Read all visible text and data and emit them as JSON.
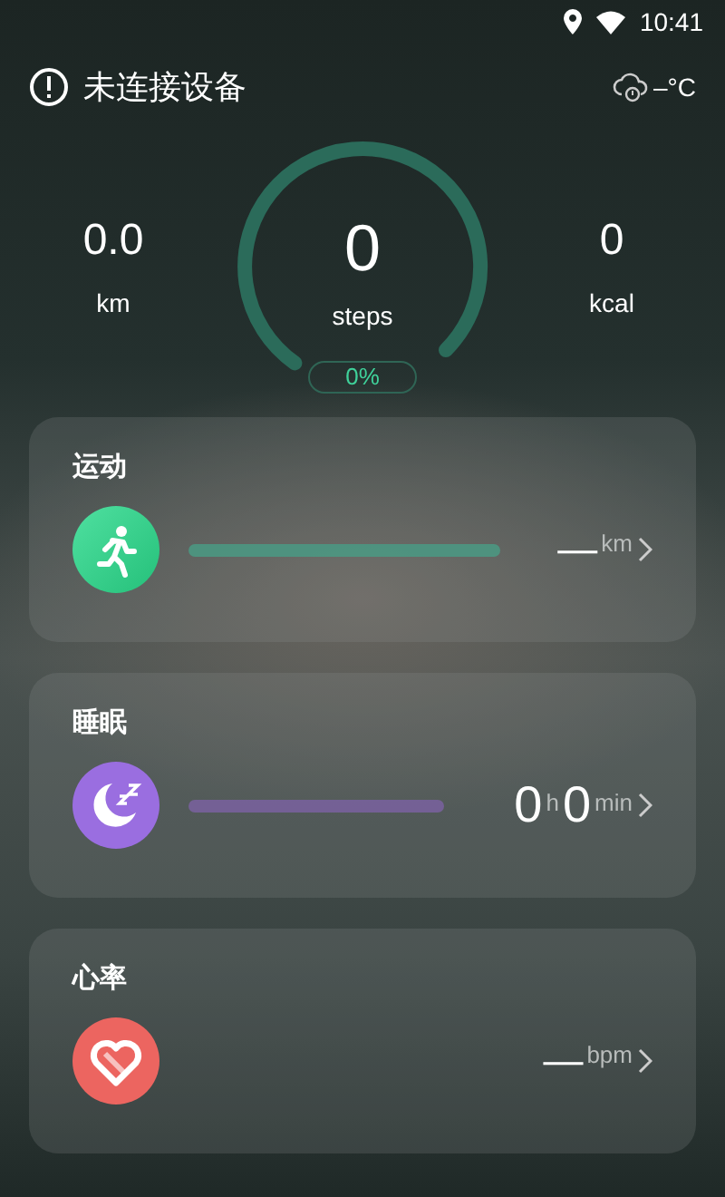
{
  "status_bar": {
    "time": "10:41"
  },
  "header": {
    "title": "未连接设备",
    "temperature": "–°C"
  },
  "summary": {
    "distance": {
      "value": "0.0",
      "unit": "km"
    },
    "steps": {
      "value": "0",
      "unit": "steps",
      "percent": "0%"
    },
    "calories": {
      "value": "0",
      "unit": "kcal"
    }
  },
  "cards": [
    {
      "kind": "exercise",
      "title": "运动",
      "color": "#4a9a84",
      "reading": [
        {
          "text": "—",
          "kind": "number"
        },
        {
          "text": "km",
          "kind": "unit"
        }
      ]
    },
    {
      "kind": "sleep",
      "title": "睡眠",
      "color": "#7a62a0",
      "reading": [
        {
          "text": "0",
          "kind": "number"
        },
        {
          "text": "h",
          "kind": "unit"
        },
        {
          "text": "0",
          "kind": "number"
        },
        {
          "text": "min",
          "kind": "unit"
        }
      ]
    },
    {
      "kind": "heart",
      "title": "心率",
      "reading": [
        {
          "text": "—",
          "kind": "number"
        },
        {
          "text": "bpm",
          "kind": "unit"
        }
      ]
    }
  ]
}
